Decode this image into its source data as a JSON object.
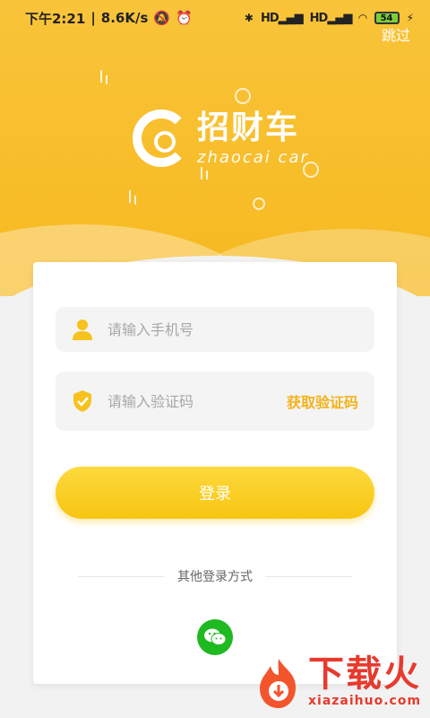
{
  "status_bar": {
    "time": "下午2:21",
    "speed": "8.6K/s",
    "signal1": "HD",
    "signal2": "HD",
    "battery": "54"
  },
  "skip_label": "跳过",
  "brand": {
    "name_cn": "招财车",
    "name_en": "zhaocai car"
  },
  "form": {
    "phone_placeholder": "请输入手机号",
    "code_placeholder": "请输入验证码",
    "get_code_label": "获取验证码",
    "login_label": "登录"
  },
  "other_login": {
    "label": "其他登录方式",
    "wechat_icon": "wechat-icon"
  },
  "watermark": {
    "cn": "下载火",
    "en": "xiazaihuo.com"
  },
  "colors": {
    "accent": "#f8c512",
    "wechat": "#1fb922",
    "watermark": "#e63b2e"
  }
}
